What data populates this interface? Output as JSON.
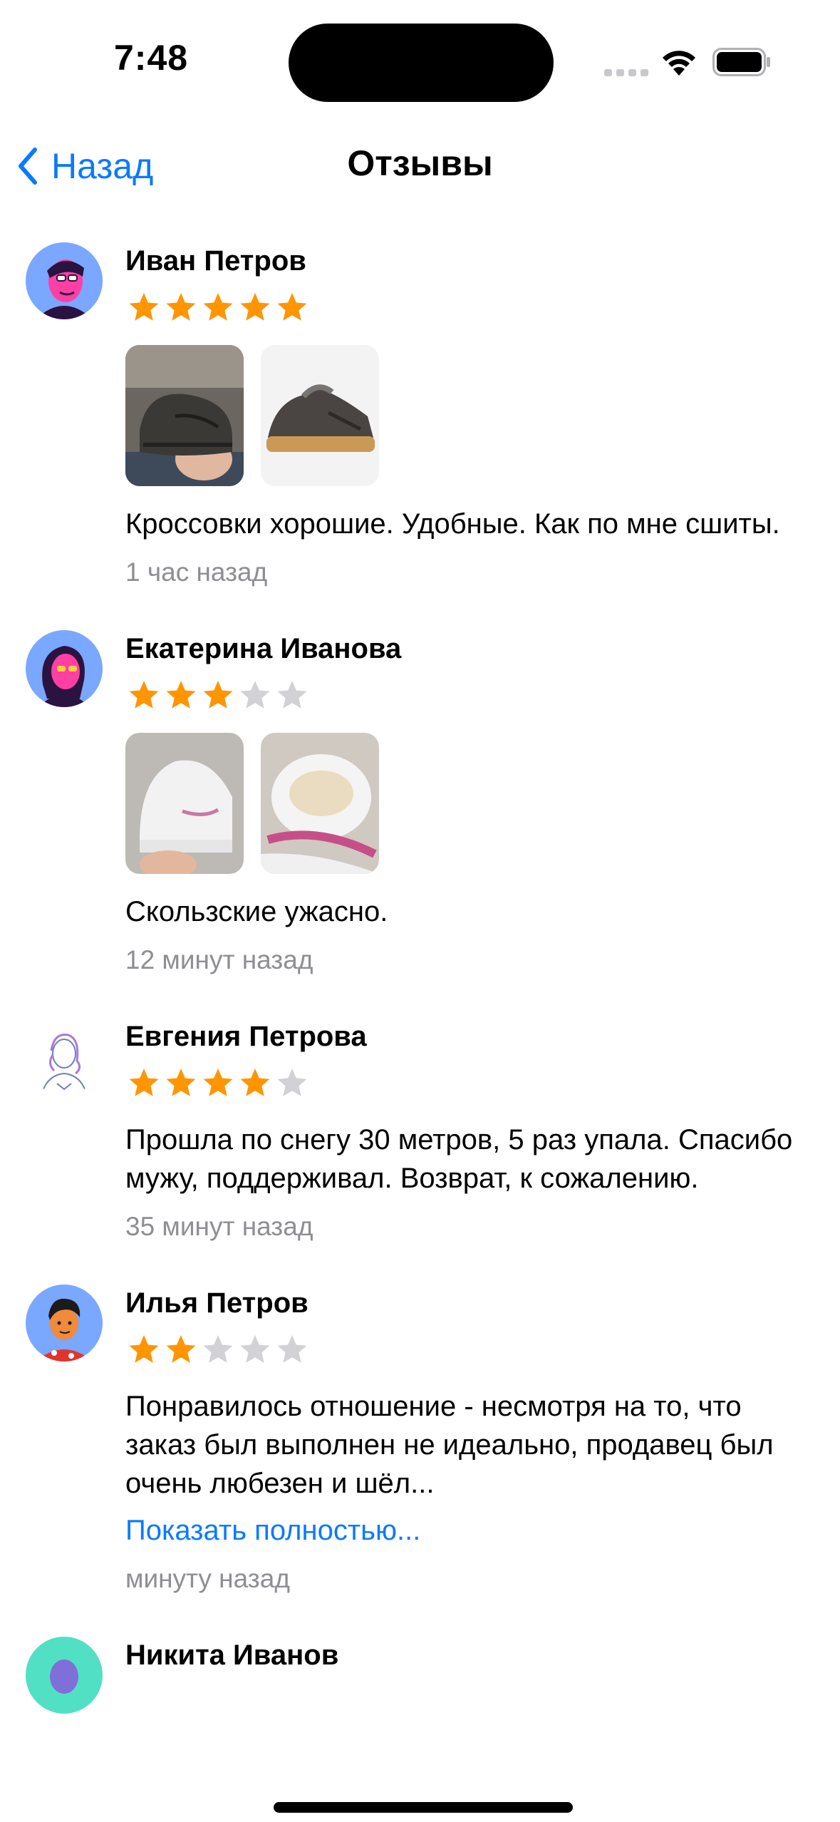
{
  "status": {
    "time": "7:48"
  },
  "nav": {
    "back_label": "Назад",
    "title": "Отзывы"
  },
  "colors": {
    "accent": "#0a7aff",
    "star_on": "#ff9500",
    "star_off": "#d1d1d6",
    "secondary_text": "#8e8e93"
  },
  "reviews": [
    {
      "name": "Иван Петров",
      "rating": 5,
      "photos": 2,
      "text": "Кроссовки хорошие. Удобные. Как по мне сшиты.",
      "time": "1 час назад"
    },
    {
      "name": "Екатерина Иванова",
      "rating": 3,
      "photos": 2,
      "text": "Скользские ужасно.",
      "time": "12 минут назад"
    },
    {
      "name": "Евгения Петрова",
      "rating": 4,
      "photos": 0,
      "text": "Прошла по снегу 30 метров, 5 раз упала. Спасибо мужу, поддерживал. Возврат, к сожалению.",
      "time": "35 минут назад"
    },
    {
      "name": "Илья Петров",
      "rating": 2,
      "photos": 0,
      "text": "Понравилось отношение - несмотря на то, что заказ был выполнен не идеально, продавец был очень любезен и шёл...",
      "show_more": "Показать полностью...",
      "time": "минуту назад"
    },
    {
      "name": "Никита Иванов"
    }
  ]
}
